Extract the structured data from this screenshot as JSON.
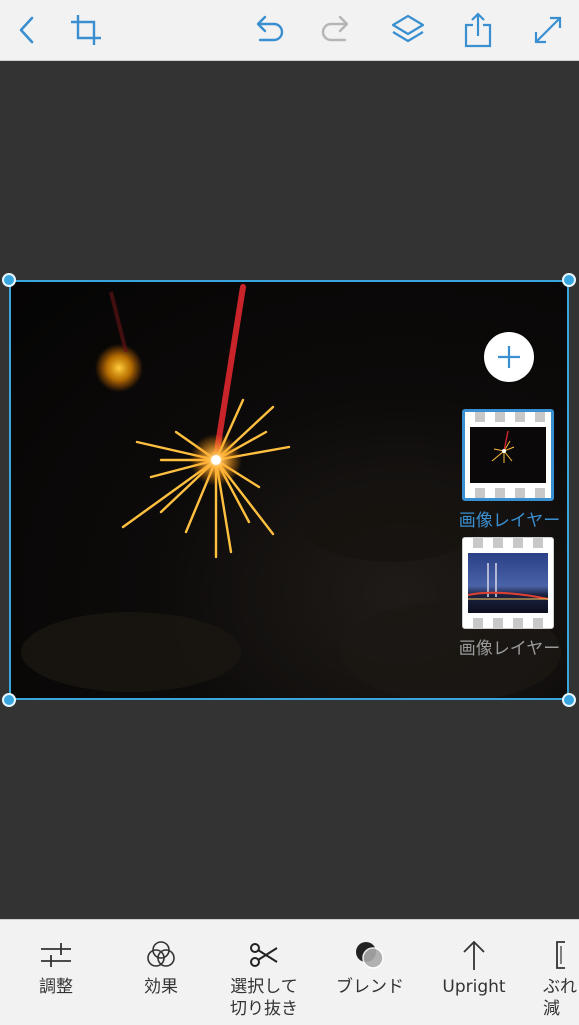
{
  "toolbar": {
    "back_icon": "chevron-left-icon",
    "crop_icon": "crop-icon",
    "undo_icon": "undo-icon",
    "redo_icon": "redo-icon",
    "layers_icon": "layers-icon",
    "share_icon": "share-icon",
    "fullscreen_icon": "expand-icon",
    "accent_color": "#3a8fd0",
    "disabled_color": "#b5b5b5"
  },
  "layers": {
    "add_icon": "plus-icon",
    "items": [
      {
        "label": "画像レイヤー",
        "selected": true
      },
      {
        "label": "画像レイヤー",
        "selected": false
      }
    ],
    "selected_color": "#3a8fd0",
    "label_color": "#9a9a9a"
  },
  "tools": [
    {
      "label": "調整",
      "icon": "sliders-icon"
    },
    {
      "label": "効果",
      "icon": "effects-icon"
    },
    {
      "label": "選択して\n切り抜き",
      "icon": "scissors-icon"
    },
    {
      "label": "ブレンド",
      "icon": "blend-icon"
    },
    {
      "label": "Upright",
      "icon": "upright-icon"
    },
    {
      "label": "ぶれ\n減",
      "icon": "shake-reduction-icon"
    }
  ],
  "selection_color": "#3aa6e0"
}
